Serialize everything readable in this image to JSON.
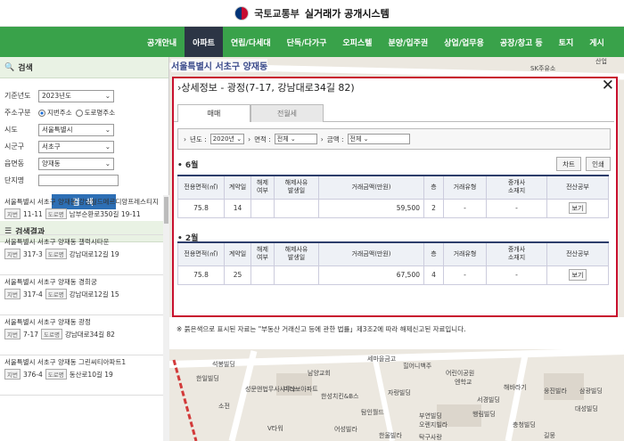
{
  "header": {
    "agency": "국토교통부",
    "title": "실거래가 공개시스템"
  },
  "nav": [
    "공개안내",
    "아파트",
    "연립/다세대",
    "단독/다가구",
    "오피스텔",
    "분양/입주권",
    "상업/업무용",
    "공장/창고 등",
    "토지",
    "게시"
  ],
  "search": {
    "heading": "검색",
    "year_label": "기준년도",
    "year_value": "2023년도",
    "addr_label": "주소구분",
    "addr_opt1": "지번주소",
    "addr_opt2": "도로명주소",
    "sido_label": "시도",
    "sido_value": "서울특별시",
    "sigungu_label": "시군구",
    "sigungu_value": "서초구",
    "dong_label": "읍면동",
    "dong_value": "양재동",
    "complex_label": "단지명",
    "button": "검 색"
  },
  "results": {
    "heading": "검색결과",
    "jibun_tag": "지번",
    "road_tag": "도로명",
    "items": [
      {
        "name": "서울특별시 서초구 양재동 강남월드메르디앙프레스티지",
        "jibun": "11-11",
        "road": "남부순환로350길 19-11"
      },
      {
        "name": "서울특별시 서초구 양재동 갤럭시타운",
        "jibun": "317-3",
        "road": "강남대로12길 19"
      },
      {
        "name": "서울특별시 서초구 양재동 경희궁",
        "jibun": "317-4",
        "road": "강남대로12길 15"
      },
      {
        "name": "서울특별시 서초구 양재동 광정",
        "jibun": "7-17",
        "road": "강남대로34길 82"
      },
      {
        "name": "서울특별시 서초구 양재동 그린씨티아파트1",
        "jibun": "376-4",
        "road": "동산로10길 19"
      }
    ]
  },
  "map": {
    "location": "서울특별시 서초구 양재동",
    "labels": [
      "석봉빌딩",
      "남양교회",
      "세마을금고",
      "힐어니백주",
      "한일빌딩",
      "성문앤법무사사무소",
      "미라보아파트",
      "한성치킨&B스",
      "자랑빌딩",
      "엔학교",
      "해바라기",
      "웅진빌라",
      "삼광빌딩",
      "탐인월드",
      "부연빌딩",
      "행림빌딩",
      "어린이공원",
      "서경빌딩",
      "탁구사랑",
      "오렌지빌라",
      "한울빌라",
      "충청빌딩",
      "대성빌딩",
      "소전",
      "V타워",
      "어성빌라",
      "SK주유소",
      "산업",
      "길뭉"
    ]
  },
  "modal": {
    "title": "상세정보 - 광정(7-17, 강남대로34길 82)",
    "tab_sale": "매매",
    "tab_rent": "전월세",
    "filter": {
      "year_label": "년도 :",
      "year_value": "2020년",
      "area_label": "면적 :",
      "area_value": "전체",
      "price_label": "금액 :",
      "price_value": "전체"
    },
    "chart_btn": "차트",
    "print_btn": "인쇄",
    "columns": [
      "전용면적(㎡)",
      "계약일",
      "해제\n여부",
      "해제사유\n발생일",
      "거래금액(만원)",
      "층",
      "거래유형",
      "중개사\n소재지",
      "전산공부"
    ],
    "months": [
      {
        "label": "6월",
        "row": {
          "area": "75.8",
          "day": "14",
          "cancel": "",
          "cancel_date": "",
          "price": "59,500",
          "floor": "2",
          "type": "-",
          "broker": "-",
          "view": "보기"
        }
      },
      {
        "label": "2월",
        "row": {
          "area": "75.8",
          "day": "25",
          "cancel": "",
          "cancel_date": "",
          "price": "67,500",
          "floor": "4",
          "type": "-",
          "broker": "-",
          "view": "보기"
        }
      }
    ]
  },
  "note": "※ 붉은색으로 표시된 자료는 \"부동산 거래신고 등에 관한 법률」제3조2에 따라 해제신고된 자료입니다."
}
